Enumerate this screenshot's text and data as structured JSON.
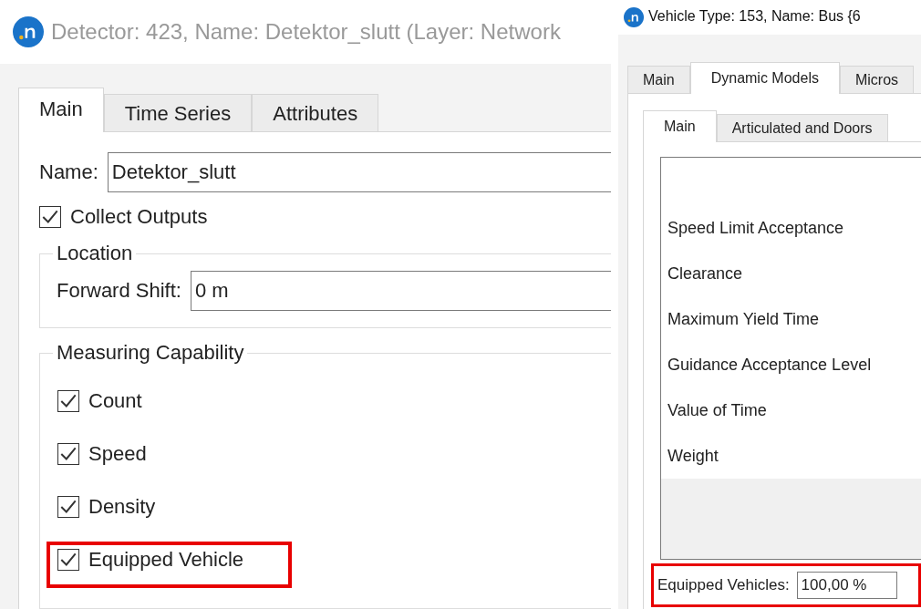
{
  "detector_window": {
    "title": "Detector: 423, Name: Detektor_slutt (Layer: Network",
    "active": false,
    "tabs": [
      {
        "label": "Main",
        "selected": true
      },
      {
        "label": "Time Series",
        "selected": false
      },
      {
        "label": "Attributes",
        "selected": false
      }
    ],
    "name_label": "Name:",
    "name_value": "Detektor_slutt",
    "collect_outputs": {
      "label": "Collect Outputs",
      "checked": true
    },
    "location": {
      "title": "Location",
      "forward_shift_label": "Forward Shift:",
      "forward_shift_value": "0 m"
    },
    "measuring_capability": {
      "title": "Measuring Capability",
      "items": [
        {
          "label": "Count",
          "checked": true,
          "highlighted": false
        },
        {
          "label": "Speed",
          "checked": true,
          "highlighted": false
        },
        {
          "label": "Density",
          "checked": true,
          "highlighted": false
        },
        {
          "label": "Equipped Vehicle",
          "checked": true,
          "highlighted": true
        }
      ]
    }
  },
  "vehicle_type_window": {
    "title": "Vehicle Type: 153, Name: Bus {6",
    "active": true,
    "tabs": [
      {
        "label": "Main",
        "selected": false
      },
      {
        "label": "Dynamic Models",
        "selected": true
      },
      {
        "label": "Micros",
        "selected": false
      }
    ],
    "subtabs": [
      {
        "label": "Main",
        "selected": true
      },
      {
        "label": "Articulated and Doors",
        "selected": false
      }
    ],
    "list_items": [
      "Speed Limit Acceptance",
      "Clearance",
      "Maximum Yield Time",
      "Guidance Acceptance Level",
      "Value of Time",
      "Weight"
    ],
    "equipped_vehicles": {
      "label": "Equipped Vehicles:",
      "value": "100,00 %",
      "highlighted": true
    }
  }
}
